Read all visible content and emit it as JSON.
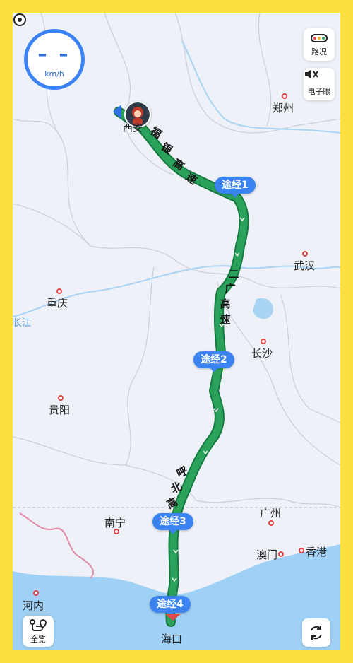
{
  "speed": {
    "value": "– –",
    "unit": "km/h"
  },
  "controls": {
    "traffic_label": "路况",
    "camera_label": "电子眼",
    "overview_label": "全览"
  },
  "cities": [
    {
      "name": "郑州",
      "id": "zhengzhou"
    },
    {
      "name": "武汉",
      "id": "wuhan"
    },
    {
      "name": "重庆",
      "id": "chongqing"
    },
    {
      "name": "长沙",
      "id": "changsha"
    },
    {
      "name": "贵阳",
      "id": "guiyang"
    },
    {
      "name": "南宁",
      "id": "nanning"
    },
    {
      "name": "广州",
      "id": "guangzhou"
    },
    {
      "name": "澳门",
      "id": "macau"
    },
    {
      "name": "香港",
      "id": "hongkong"
    },
    {
      "name": "河内",
      "id": "hanoi"
    },
    {
      "name": "海口",
      "id": "haikou"
    },
    {
      "name": "长江",
      "id": "yangtze"
    }
  ],
  "start_label": "西安",
  "waypoints": [
    "途经1",
    "途经2",
    "途经3",
    "途经4"
  ],
  "road_labels": {
    "fuyin": [
      "福",
      "银",
      "高",
      "速"
    ],
    "erguang": [
      "二",
      "广",
      "高",
      "速"
    ],
    "huobei": [
      "呼",
      "北",
      "高"
    ]
  },
  "colors": {
    "route": "#1E8E4E",
    "route_outline": "#157A40",
    "waypoint": "#3A83F0",
    "frame": "#FDDF3E"
  }
}
